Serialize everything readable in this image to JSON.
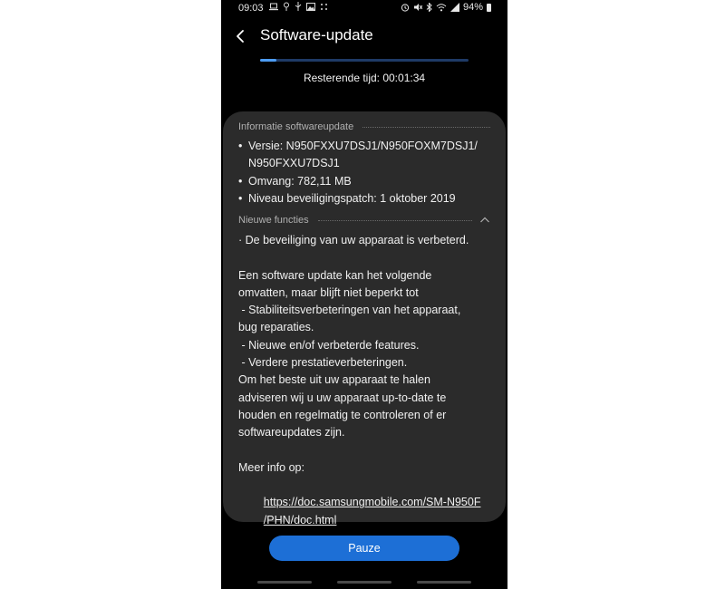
{
  "statusbar": {
    "time": "09:03",
    "battery": "94%",
    "left_icons": [
      "laptop-icon",
      "pin-icon",
      "usb-icon",
      "image-icon",
      "more-dots-icon"
    ],
    "right_icons": [
      "alarm-icon",
      "mute-icon",
      "bluetooth-icon",
      "wifi-icon",
      "signal-icon",
      "battery-icon"
    ]
  },
  "header": {
    "title": "Software-update"
  },
  "progress": {
    "fraction": 0.08,
    "remaining_text": "Resterende tijd: 00:01:34"
  },
  "info": {
    "section_title": "Informatie softwareupdate",
    "version_line1": "Versie: N950FXXU7DSJ1/N950FOXM7DSJ1/",
    "version_line2": "N950FXXU7DSJ1",
    "size": "Omvang: 782,11 MB",
    "patch": "Niveau beveiligingspatch: 1 oktober 2019"
  },
  "new_features": {
    "section_title": "Nieuwe functies",
    "lines": [
      "· De beveiliging van uw apparaat is verbeterd.",
      "",
      "Een software update kan het volgende",
      "omvatten, maar blijft niet beperkt tot",
      " - Stabiliteitsverbeteringen van het apparaat,",
      "bug reparaties.",
      " - Nieuwe en/of verbeterde features.",
      " - Verdere prestatieverbeteringen.",
      "Om het beste uit uw apparaat te halen",
      "adviseren wij u uw apparaat up-to-date te",
      "houden en regelmatig te controleren of er",
      "softwareupdates zijn.",
      "",
      "Meer info op:"
    ],
    "link_line1": "https://doc.samsungmobile.com/SM-N950F",
    "link_line2": "/PHN/doc.html"
  },
  "actions": {
    "pause_label": "Pauze"
  },
  "colors": {
    "accent": "#1d6fd6",
    "progress": "#4d9cf2",
    "card": "#2b2b2b",
    "background": "#000000"
  }
}
